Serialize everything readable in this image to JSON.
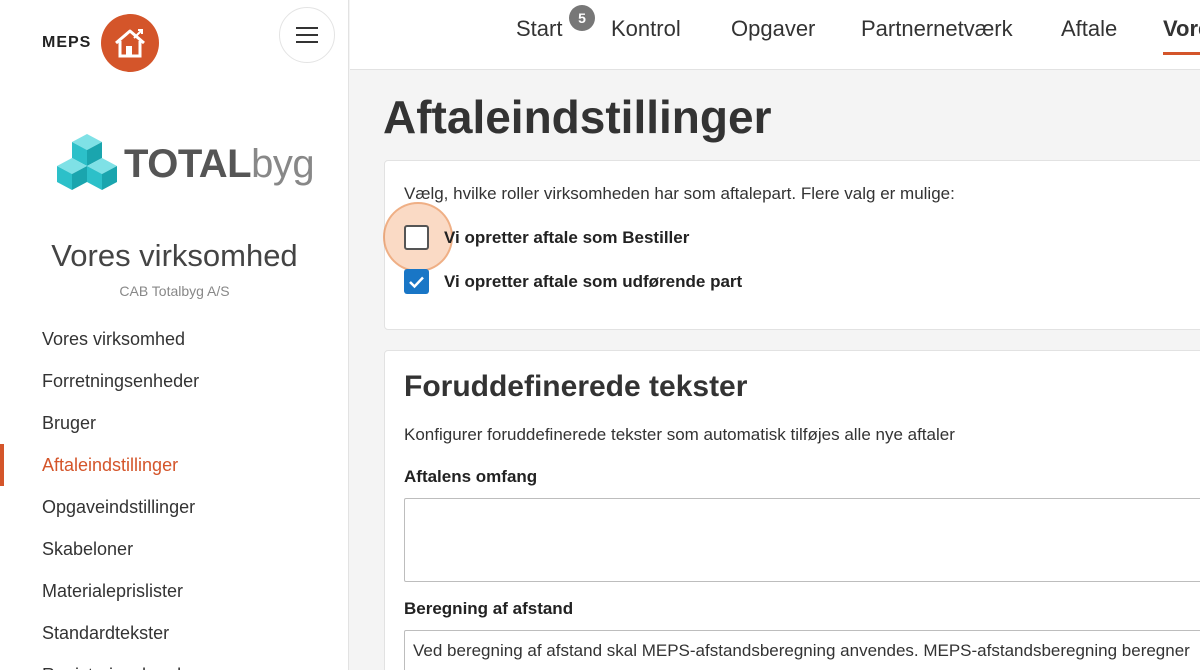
{
  "brand": {
    "name": "MEPS",
    "logo_icon": "house-icon"
  },
  "menu": {
    "icon": "hamburger-icon"
  },
  "company_logo": {
    "bold": "TOTAL",
    "light": "byg",
    "icon": "cubes-icon"
  },
  "organization": {
    "title": "Vores virksomhed",
    "subtitle": "CAB Totalbyg A/S"
  },
  "sidebar": {
    "items": [
      {
        "label": "Vores virksomhed",
        "active": false
      },
      {
        "label": "Forretningsenheder",
        "active": false
      },
      {
        "label": "Bruger",
        "active": false
      },
      {
        "label": "Aftaleindstillinger",
        "active": true
      },
      {
        "label": "Opgaveindstillinger",
        "active": false
      },
      {
        "label": "Skabeloner",
        "active": false
      },
      {
        "label": "Materialeprislister",
        "active": false
      },
      {
        "label": "Standardtekster",
        "active": false
      },
      {
        "label": "Registeringshaydr",
        "active": false
      }
    ]
  },
  "topnav": {
    "tabs": [
      {
        "label": "Start",
        "active": false
      },
      {
        "label": "Kontrol",
        "active": false
      },
      {
        "label": "Opgaver",
        "active": false
      },
      {
        "label": "Partnernetværk",
        "active": false
      },
      {
        "label": "Aftale",
        "active": false
      },
      {
        "label": "Vores",
        "active": true
      }
    ],
    "badge": "5"
  },
  "page": {
    "title": "Aftaleindstillinger"
  },
  "roles": {
    "intro": "Vælg, hvilke roller virksomheden har som aftalepart. Flere valg er mulige:",
    "options": [
      {
        "label": "Vi opretter aftale som Bestiller",
        "checked": false
      },
      {
        "label": "Vi opretter aftale som udførende part",
        "checked": true
      }
    ]
  },
  "predefined": {
    "title": "Foruddefinerede tekster",
    "description": "Konfigurer foruddefinerede tekster som automatisk tilføjes alle nye aftaler",
    "fields": [
      {
        "label": "Aftalens omfang",
        "value": ""
      },
      {
        "label": "Beregning af afstand",
        "value": "Ved beregning af afstand skal MEPS-afstandsberegning anvendes. MEPS-afstandsberegning beregner"
      }
    ]
  },
  "colors": {
    "accent": "#d4552a",
    "checkbox": "#1976c6"
  }
}
